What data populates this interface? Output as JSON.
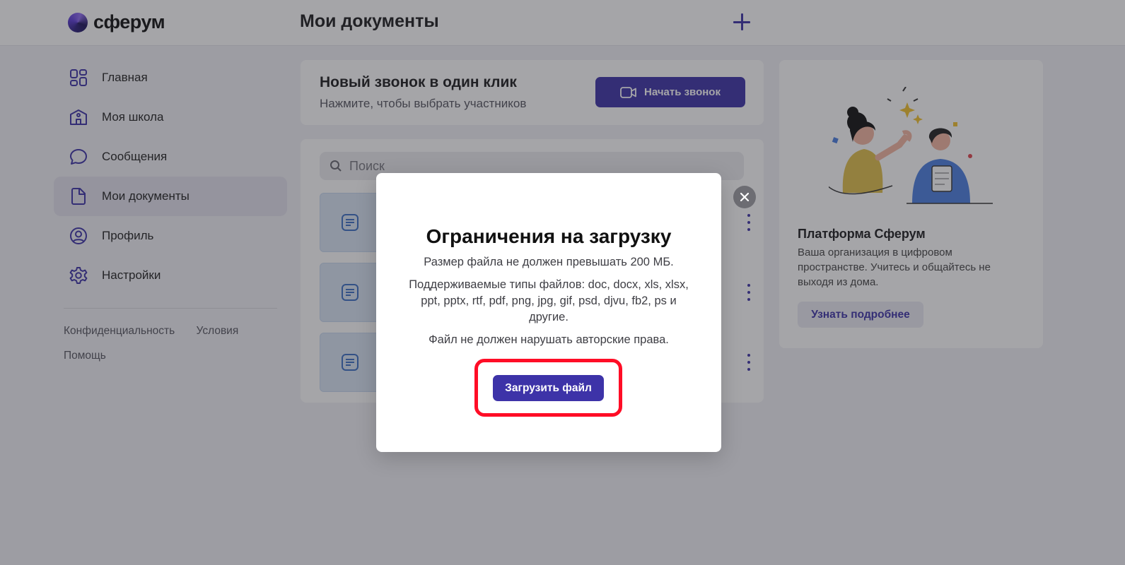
{
  "app": {
    "logo_text": "сферум"
  },
  "header": {
    "title": "Мои документы",
    "add_icon": "plus-icon"
  },
  "sidebar": {
    "items": [
      {
        "label": "Главная",
        "icon": "home-grid-icon",
        "active": false
      },
      {
        "label": "Моя школа",
        "icon": "school-icon",
        "active": false
      },
      {
        "label": "Сообщения",
        "icon": "message-bubble-icon",
        "active": false
      },
      {
        "label": "Мои документы",
        "icon": "document-icon",
        "active": true
      },
      {
        "label": "Профиль",
        "icon": "profile-icon",
        "active": false
      },
      {
        "label": "Настройки",
        "icon": "gear-icon",
        "active": false
      }
    ],
    "footer": {
      "privacy": "Конфиденциальность",
      "terms": "Условия",
      "help": "Помощь"
    }
  },
  "call_card": {
    "title": "Новый звонок в один клик",
    "subtitle": "Нажмите, чтобы выбрать участников",
    "button_label": "Начать звонок"
  },
  "documents": {
    "search_placeholder": "Поиск",
    "rows_count_visible": 3
  },
  "promo": {
    "title": "Платформа Сферум",
    "text": "Ваша организация в цифровом пространстве. Учитесь и общайтесь не выходя из дома.",
    "button_label": "Узнать подробнее"
  },
  "modal": {
    "title": "Ограничения на загрузку",
    "line1": "Размер файла не должен превышать 200 МБ.",
    "line2": "Поддерживаемые типы файлов: doc, docx, xls, xlsx, ppt, pptx, rtf, pdf, png, jpg, gif, psd, djvu, fb2, ps и другие.",
    "line3": "Файл не должен нарушать авторские права.",
    "button_label": "Загрузить файл"
  },
  "colors": {
    "accent": "#3d33a8",
    "highlight": "#ff0d26",
    "overlay": "rgba(40,40,48,0.42)"
  }
}
